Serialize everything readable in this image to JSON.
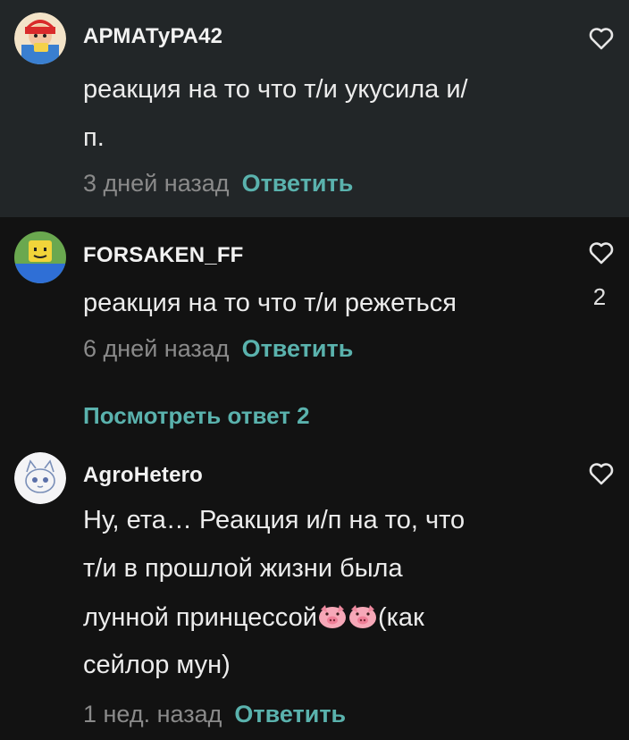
{
  "comments": [
    {
      "username": "АРМАТуРА42",
      "lines": [
        "реакция на то что т/и укусила и/",
        "п."
      ],
      "time": "3 дней назад",
      "reply": "Ответить",
      "likes": ""
    },
    {
      "username": "FORSAKEN_FF",
      "lines": [
        "реакция на то что т/и режеться"
      ],
      "time": "6 дней назад",
      "reply": "Ответить",
      "likes": "2"
    },
    {
      "username": "AgroHetero",
      "lines": [
        "Ну, ета… Реакция и/п на то, что",
        "т/и в прошлой жизни была",
        "лунной принцессой",
        "(как",
        "сейлор мун)"
      ],
      "time": "1 нед. назад",
      "reply": "Ответить",
      "likes": ""
    }
  ],
  "view_replies": "Посмотреть ответ 2",
  "icons": {
    "like": "heart-outline-icon",
    "emoji": "pig-face-emoji"
  },
  "colors": {
    "accent": "#5ab2ad",
    "highlight_bg": "#222628",
    "bg": "#121212"
  }
}
